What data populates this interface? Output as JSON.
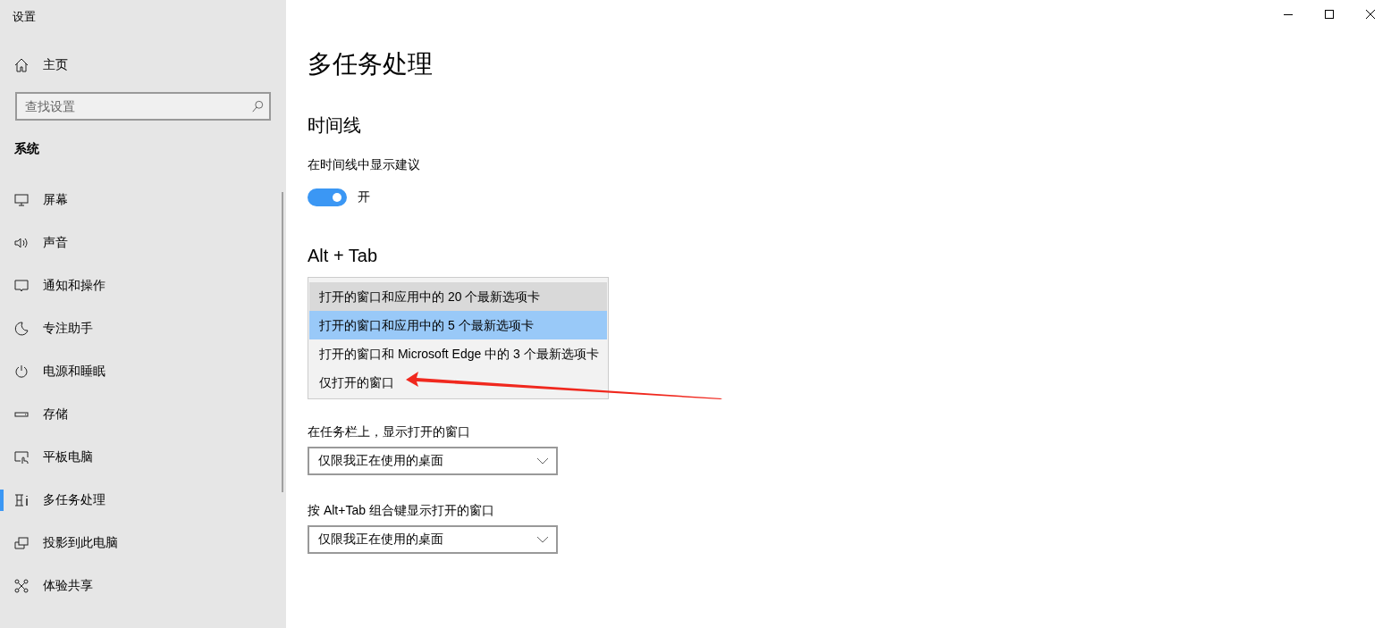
{
  "window": {
    "title": "设置"
  },
  "sidebar": {
    "home": "主页",
    "search": {
      "placeholder": "查找设置"
    },
    "section": "系统",
    "items": [
      {
        "label": "屏幕",
        "selected": false
      },
      {
        "label": "声音",
        "selected": false
      },
      {
        "label": "通知和操作",
        "selected": false
      },
      {
        "label": "专注助手",
        "selected": false
      },
      {
        "label": "电源和睡眠",
        "selected": false
      },
      {
        "label": "存储",
        "selected": false
      },
      {
        "label": "平板电脑",
        "selected": false
      },
      {
        "label": "多任务处理",
        "selected": true
      },
      {
        "label": "投影到此电脑",
        "selected": false
      },
      {
        "label": "体验共享",
        "selected": false
      }
    ]
  },
  "page": {
    "title": "多任务处理",
    "timeline": {
      "heading": "时间线",
      "label": "在时间线中显示建议",
      "on": true,
      "state_text": "开"
    },
    "alt_tab": {
      "heading": "Alt + Tab",
      "options": [
        {
          "label": "打开的窗口和应用中的 20 个最新选项卡",
          "highlighted": true,
          "selected": false
        },
        {
          "label": "打开的窗口和应用中的 5 个最新选项卡",
          "highlighted": false,
          "selected": true
        },
        {
          "label": "打开的窗口和 Microsoft Edge 中的 3 个最新选项卡",
          "highlighted": false,
          "selected": false
        },
        {
          "label": "仅打开的窗口",
          "highlighted": false,
          "selected": false
        }
      ]
    },
    "selects": [
      {
        "label": "在任务栏上，显示打开的窗口",
        "value": "仅限我正在使用的桌面"
      },
      {
        "label": "按 Alt+Tab 组合键显示打开的窗口",
        "value": "仅限我正在使用的桌面"
      }
    ]
  }
}
